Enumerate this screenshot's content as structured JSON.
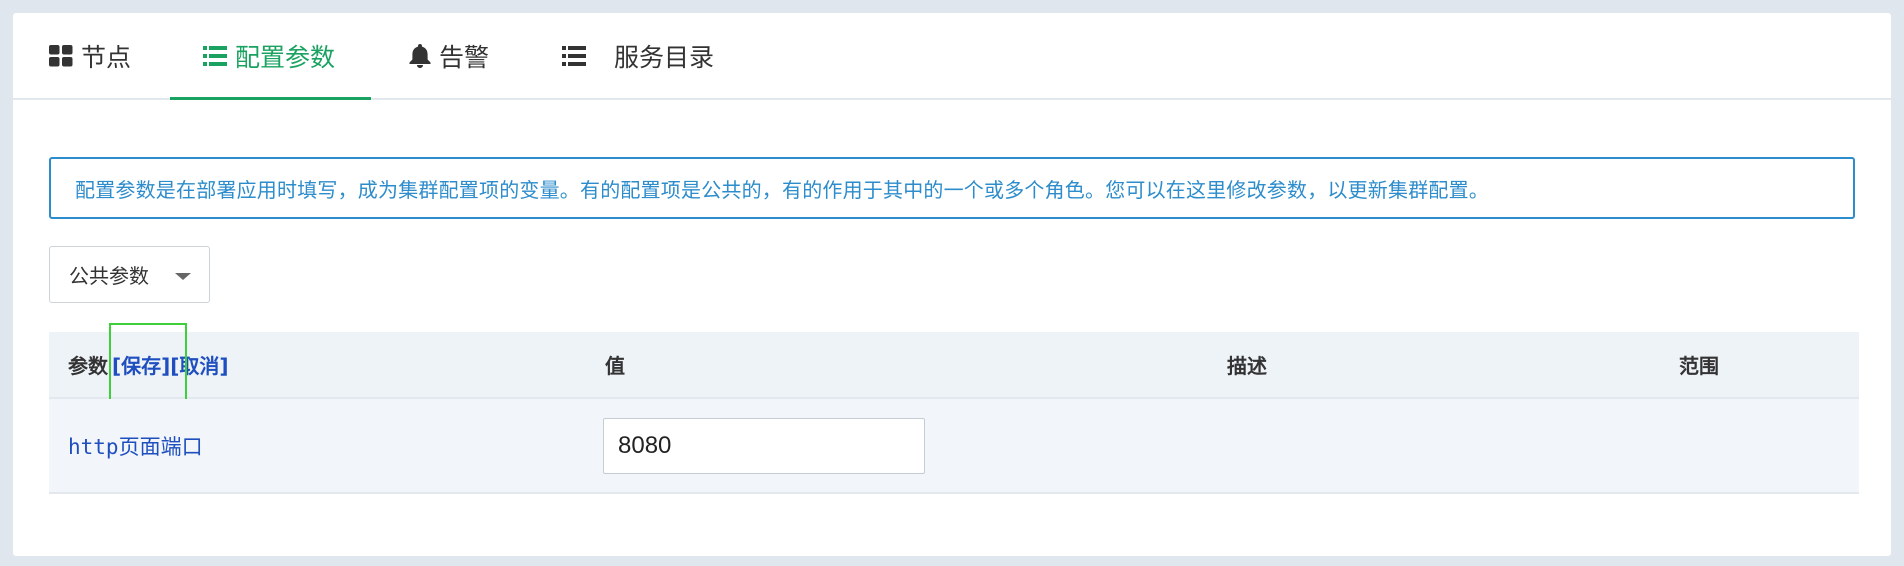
{
  "tabs": [
    {
      "label": "节点",
      "icon": "grid-icon"
    },
    {
      "label": "配置参数",
      "icon": "list-icon",
      "active": true
    },
    {
      "label": "告警",
      "icon": "bell-icon"
    },
    {
      "label": "服务目录",
      "icon": "list-icon"
    }
  ],
  "colors": {
    "accent": "#1aa260",
    "info": "#2d8ccb",
    "link": "#1f4fbf",
    "focus": "#3fcf3a"
  },
  "alert": {
    "text": "配置参数是在部署应用时填写，成为集群配置项的变量。有的配置项是公共的，有的作用于其中的一个或多个角色。您可以在这里修改参数，以更新集群配置。"
  },
  "scope_select": {
    "value": "公共参数"
  },
  "table": {
    "headers": {
      "param": "参数",
      "save": "[保存]",
      "cancel": "[取消]",
      "value": "值",
      "description": "描述",
      "scope": "范围"
    },
    "rows": [
      {
        "param": "http页面端口",
        "value": "8080",
        "description": "",
        "scope": ""
      }
    ]
  }
}
